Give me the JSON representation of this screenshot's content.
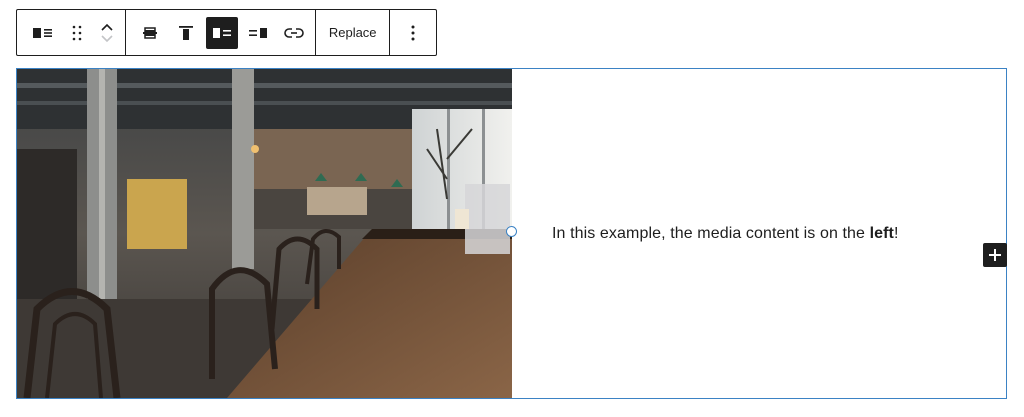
{
  "toolbar": {
    "replace_label": "Replace"
  },
  "content": {
    "text_before": "In this example, the media content is on the ",
    "text_bold": "left",
    "text_after": "!"
  },
  "colors": {
    "selection_border": "#3b82c4",
    "toolbar_dark": "#1e1e1e",
    "active_button": "#1e1e1e"
  },
  "icons": [
    "media-text-block-icon",
    "drag-handle-icon",
    "move-up-icon",
    "move-down-icon",
    "align-center-icon",
    "align-top-icon",
    "media-left-icon",
    "media-right-icon",
    "link-icon",
    "more-options-icon",
    "add-block-icon"
  ]
}
